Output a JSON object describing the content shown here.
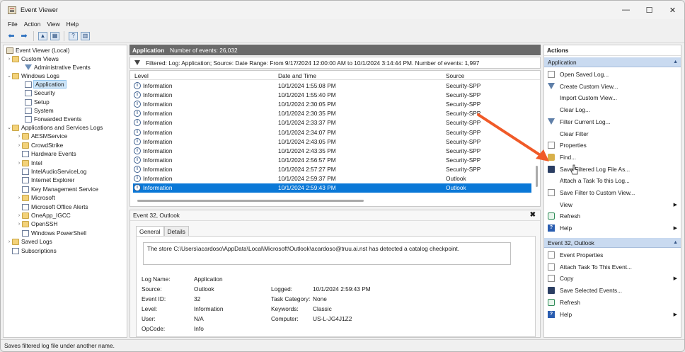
{
  "window": {
    "title": "Event Viewer",
    "minimize": "—",
    "maximize": "☐",
    "close": "✕"
  },
  "menu": [
    "File",
    "Action",
    "View",
    "Help"
  ],
  "tree": {
    "root": "Event Viewer (Local)",
    "custom_views": "Custom Views",
    "admin_events": "Administrative Events",
    "windows_logs": "Windows Logs",
    "application": "Application",
    "security": "Security",
    "setup": "Setup",
    "system": "System",
    "forwarded": "Forwarded Events",
    "apps_services": "Applications and Services Logs",
    "apps_children": [
      "AESMService",
      "CrowdStrike",
      "Hardware Events",
      "Intel",
      "IntelAudioServiceLog",
      "Internet Explorer",
      "Key Management Service",
      "Microsoft",
      "Microsoft Office Alerts",
      "OneApp_IGCC",
      "OpenSSH",
      "Windows PowerShell"
    ],
    "saved_logs": "Saved Logs",
    "subscriptions": "Subscriptions"
  },
  "center": {
    "pane_title": "Application",
    "pane_count": "Number of events: 26,032",
    "filter_text": "Filtered: Log: Application; Source: Date Range: From 9/17/2024 12:00:00 AM to 10/1/2024 3:14:44 PM. Number of events: 1,997",
    "columns": {
      "level": "Level",
      "date": "Date and Time",
      "source": "Source"
    },
    "rows": [
      {
        "level": "Information",
        "date": "10/1/2024 1:55:08 PM",
        "source": "Security-SPP"
      },
      {
        "level": "Information",
        "date": "10/1/2024 1:55:40 PM",
        "source": "Security-SPP"
      },
      {
        "level": "Information",
        "date": "10/1/2024 2:30:05 PM",
        "source": "Security-SPP"
      },
      {
        "level": "Information",
        "date": "10/1/2024 2:30:35 PM",
        "source": "Security-SPP"
      },
      {
        "level": "Information",
        "date": "10/1/2024 2:33:37 PM",
        "source": "Security-SPP"
      },
      {
        "level": "Information",
        "date": "10/1/2024 2:34:07 PM",
        "source": "Security-SPP"
      },
      {
        "level": "Information",
        "date": "10/1/2024 2:43:05 PM",
        "source": "Security-SPP"
      },
      {
        "level": "Information",
        "date": "10/1/2024 2:43:35 PM",
        "source": "Security-SPP"
      },
      {
        "level": "Information",
        "date": "10/1/2024 2:56:57 PM",
        "source": "Security-SPP"
      },
      {
        "level": "Information",
        "date": "10/1/2024 2:57:27 PM",
        "source": "Security-SPP"
      },
      {
        "level": "Information",
        "date": "10/1/2024 2:59:37 PM",
        "source": "Outlook"
      },
      {
        "level": "Information",
        "date": "10/1/2024 2:59:43 PM",
        "source": "Outlook"
      }
    ],
    "detail": {
      "header": "Event 32, Outlook",
      "close": "✖",
      "tab_general": "General",
      "tab_details": "Details",
      "message": "The store C:\\Users\\acardoso\\AppData\\Local\\Microsoft\\Outlook\\acardoso@truu.ai.nst has detected a catalog checkpoint.",
      "log_name_label": "Log Name:",
      "log_name": "Application",
      "source_label": "Source:",
      "source": "Outlook",
      "logged_label": "Logged:",
      "logged": "10/1/2024 2:59:43 PM",
      "event_id_label": "Event ID:",
      "event_id": "32",
      "task_cat_label": "Task Category:",
      "task_cat": "None",
      "level_label": "Level:",
      "level": "Information",
      "keywords_label": "Keywords:",
      "keywords": "Classic",
      "user_label": "User:",
      "user": "N/A",
      "computer_label": "Computer:",
      "computer": "US-L-JG4J1Z2",
      "opcode_label": "OpCode:",
      "opcode": "Info"
    }
  },
  "actions": {
    "header": "Actions",
    "section1": "Application",
    "items1": [
      {
        "label": "Open Saved Log...",
        "icon": "doc"
      },
      {
        "label": "Create Custom View...",
        "icon": "filt"
      },
      {
        "label": "Import Custom View...",
        "icon": "none"
      },
      {
        "label": "Clear Log...",
        "icon": "none"
      },
      {
        "label": "Filter Current Log...",
        "icon": "filt"
      },
      {
        "label": "Clear Filter",
        "icon": "none"
      },
      {
        "label": "Properties",
        "icon": "doc"
      },
      {
        "label": "Find...",
        "icon": "gear"
      },
      {
        "label": "Save Filtered Log File As...",
        "icon": "save"
      },
      {
        "label": "Attach a Task To this Log...",
        "icon": "none"
      },
      {
        "label": "Save Filter to Custom View...",
        "icon": "doc"
      },
      {
        "label": "View",
        "icon": "none",
        "sub": "▶"
      },
      {
        "label": "Refresh",
        "icon": "refresh"
      },
      {
        "label": "Help",
        "icon": "help",
        "sub": "▶"
      }
    ],
    "section2": "Event 32, Outlook",
    "items2": [
      {
        "label": "Event Properties",
        "icon": "doc"
      },
      {
        "label": "Attach Task To This Event...",
        "icon": "doc"
      },
      {
        "label": "Copy",
        "icon": "doc",
        "sub": "▶"
      },
      {
        "label": "Save Selected Events...",
        "icon": "save"
      },
      {
        "label": "Refresh",
        "icon": "refresh"
      },
      {
        "label": "Help",
        "icon": "help",
        "sub": "▶"
      }
    ]
  },
  "status": "Saves filtered log file under another name.",
  "colors": {
    "selection": "#0a78d7",
    "annotation_arrow": "#f05a28",
    "section_header": "#c9daf0"
  }
}
